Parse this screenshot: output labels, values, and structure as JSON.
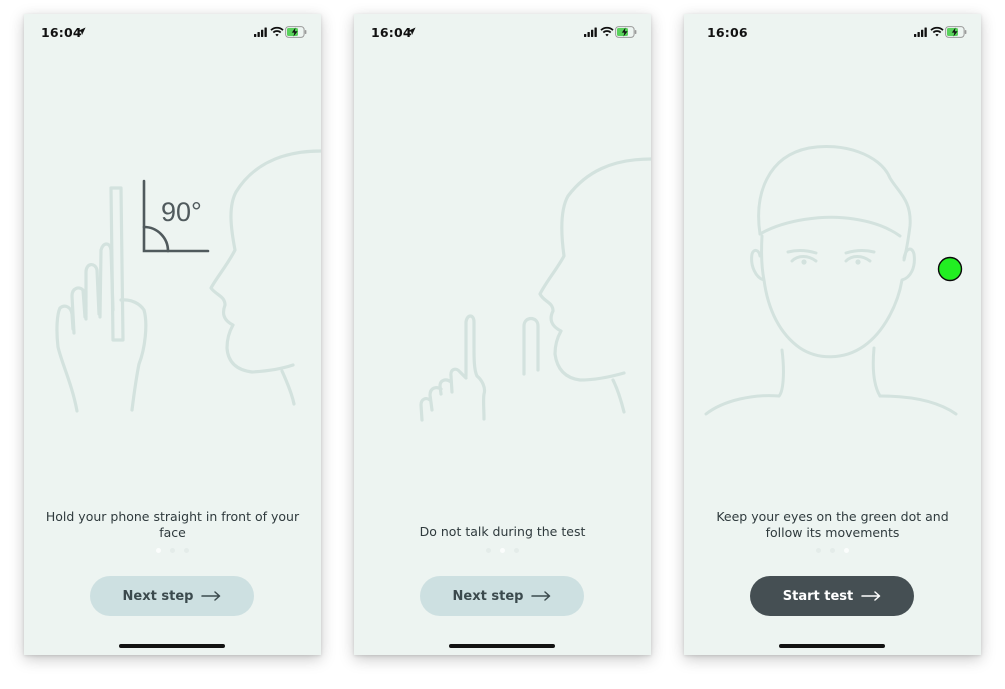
{
  "colors": {
    "screen_bg": "#edf4f1",
    "line_art": "#d3e2de",
    "angle_mark": "#505a5d",
    "button_secondary": "#cde0e1",
    "button_primary": "#454f53",
    "green_dot": "#22ee22",
    "battery_green": "#59d15c"
  },
  "screens": [
    {
      "status": {
        "time": "16:04",
        "location_icon": "location-arrow-icon"
      },
      "angle_label": "90°",
      "caption": "Hold your phone straight in front of your face",
      "button_label": "Next step",
      "step_index": 0
    },
    {
      "status": {
        "time": "16:04",
        "location_icon": "location-arrow-icon"
      },
      "caption": "Do not talk during the test",
      "button_label": "Next step",
      "step_index": 1
    },
    {
      "status": {
        "time": "16:06"
      },
      "caption": "Keep your eyes on the green dot and follow its movements",
      "button_label": "Start test",
      "step_index": 2
    }
  ],
  "pagination": {
    "total_steps": 3
  },
  "icons": {
    "signal": "cellular-signal-icon",
    "wifi": "wifi-icon",
    "battery": "battery-charging-icon",
    "arrow": "arrow-right-icon"
  }
}
